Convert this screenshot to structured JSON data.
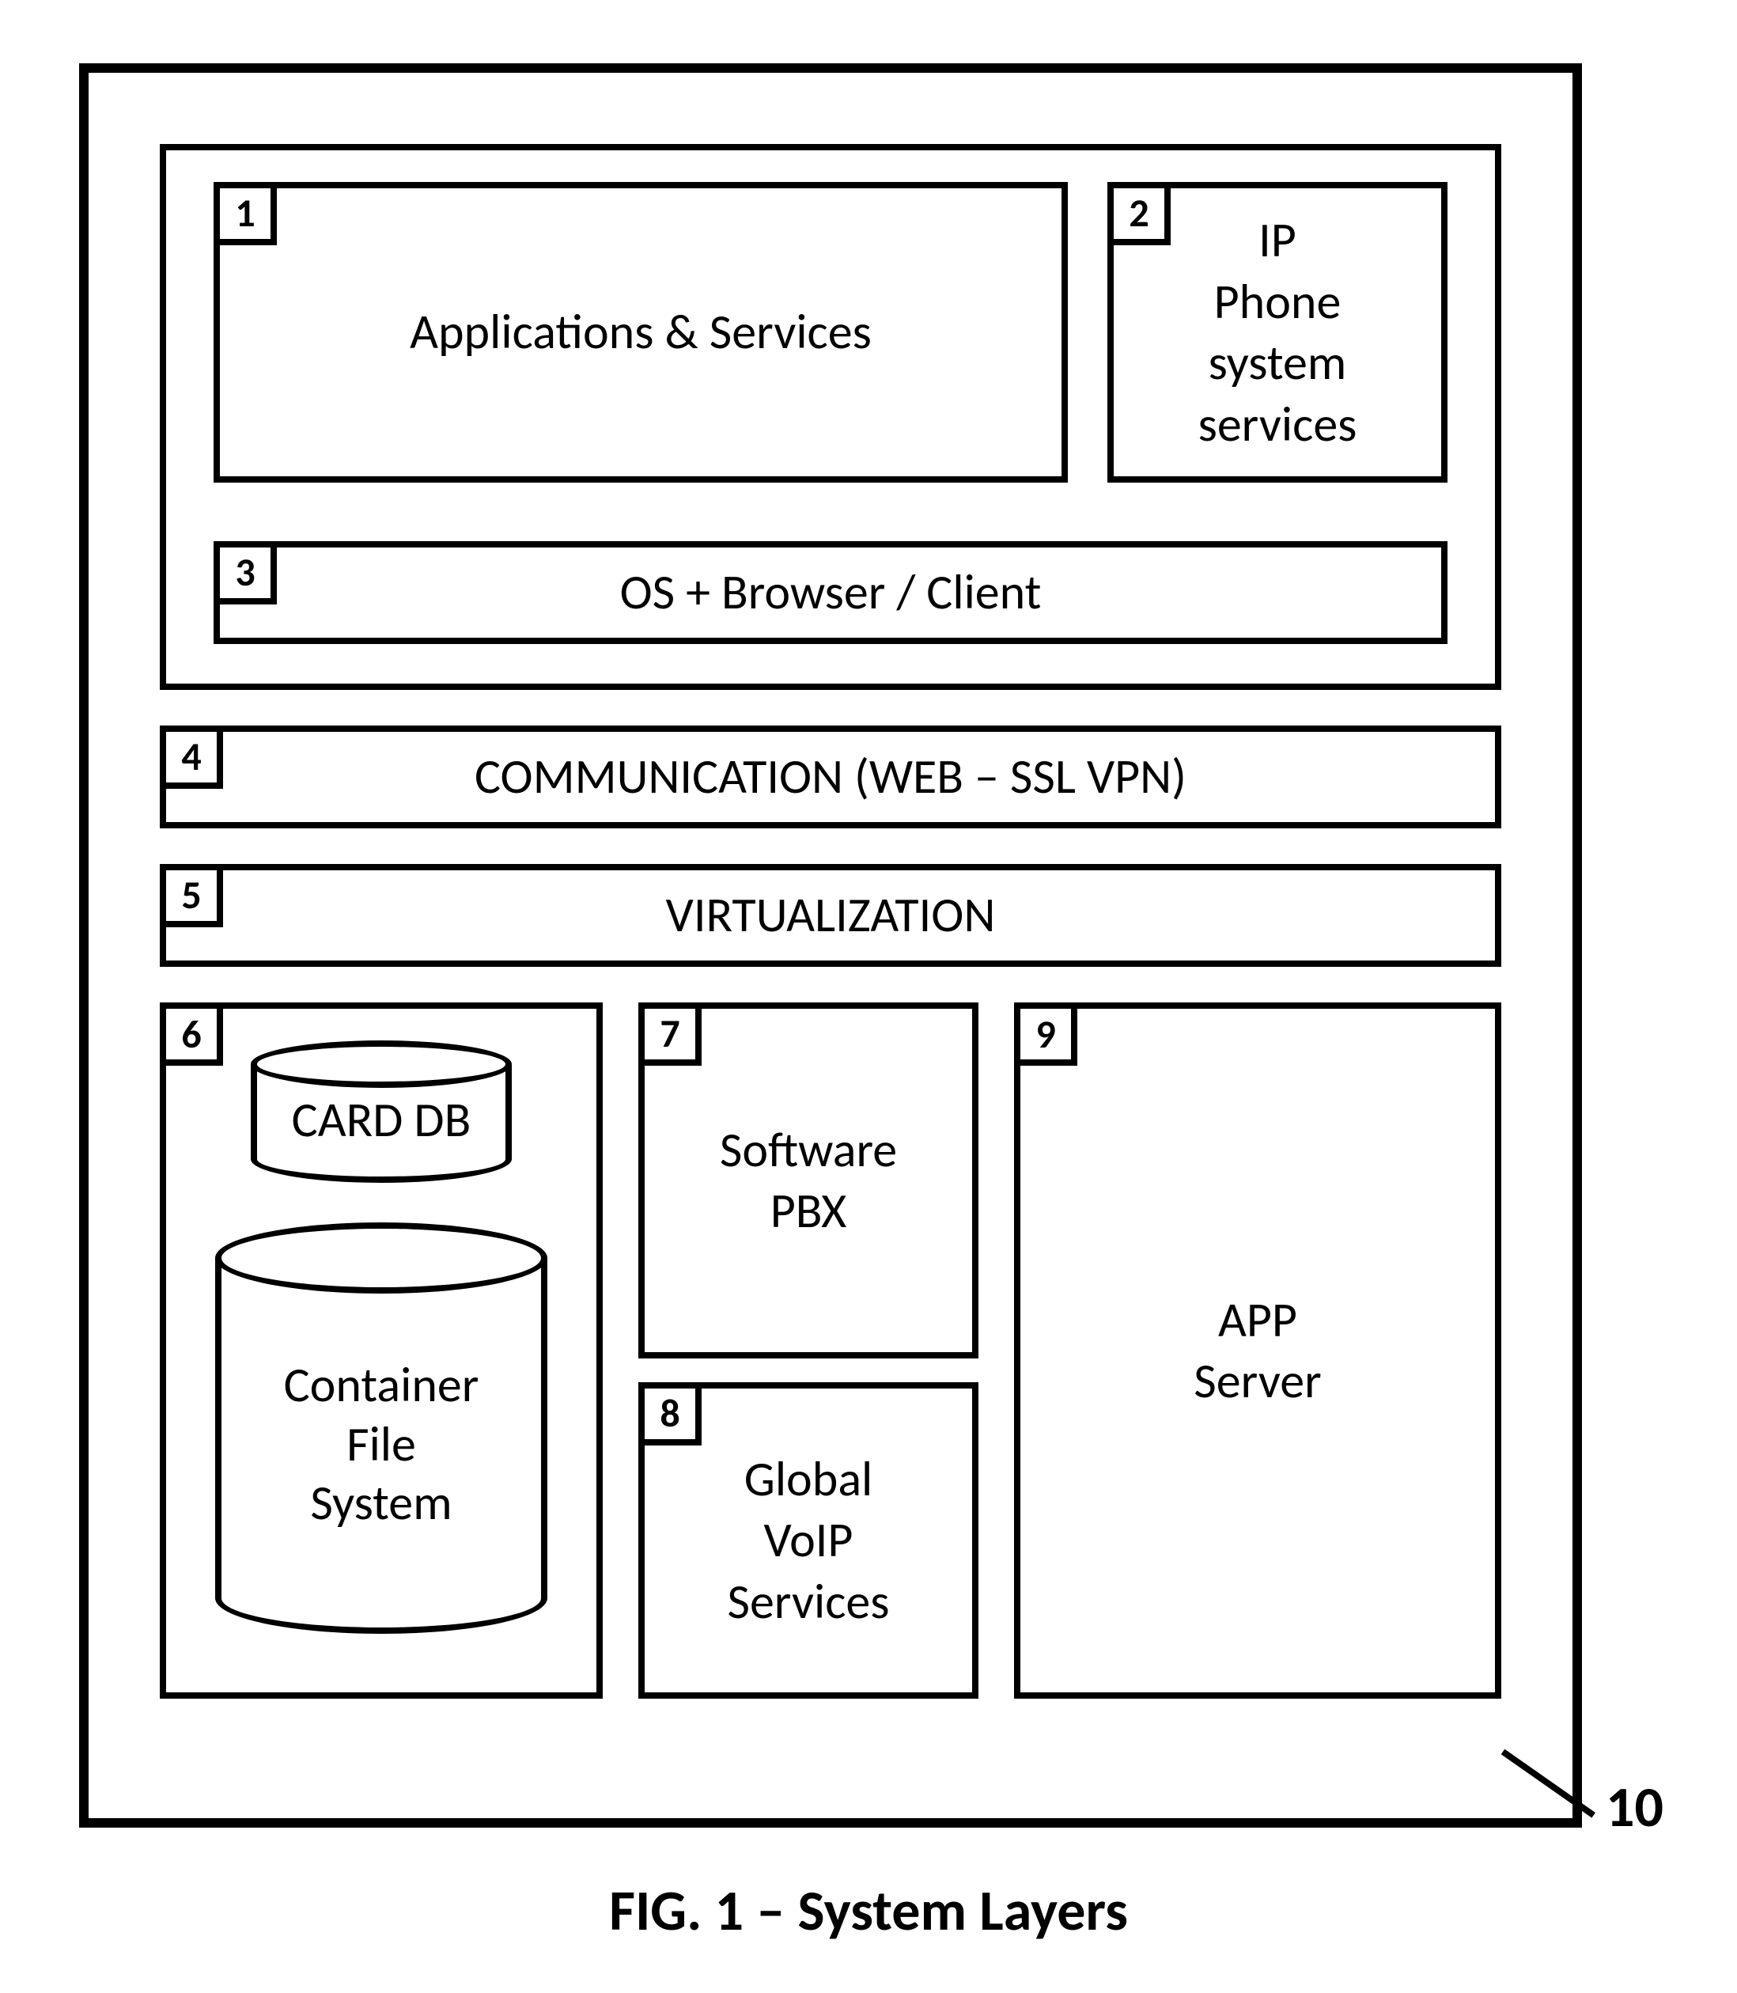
{
  "figure": {
    "caption": "FIG. 1 – System Layers",
    "ref_number": "10"
  },
  "boxes": {
    "b1": {
      "num": "1",
      "label": "Applications & Services"
    },
    "b2": {
      "num": "2",
      "label": "IP\nPhone\nsystem\nservices"
    },
    "b3": {
      "num": "3",
      "label": "OS + Browser / Client"
    },
    "b4": {
      "num": "4",
      "label": "COMMUNICATION (WEB – SSL VPN)"
    },
    "b5": {
      "num": "5",
      "label": "VIRTUALIZATION"
    },
    "b6": {
      "num": "6",
      "card_label": "CARD DB",
      "container_label": "Container\nFile\nSystem"
    },
    "b7": {
      "num": "7",
      "label": "Software\nPBX"
    },
    "b8": {
      "num": "8",
      "label": "Global\nVoIP\nServices"
    },
    "b9": {
      "num": "9",
      "label": "APP\nServer"
    }
  }
}
